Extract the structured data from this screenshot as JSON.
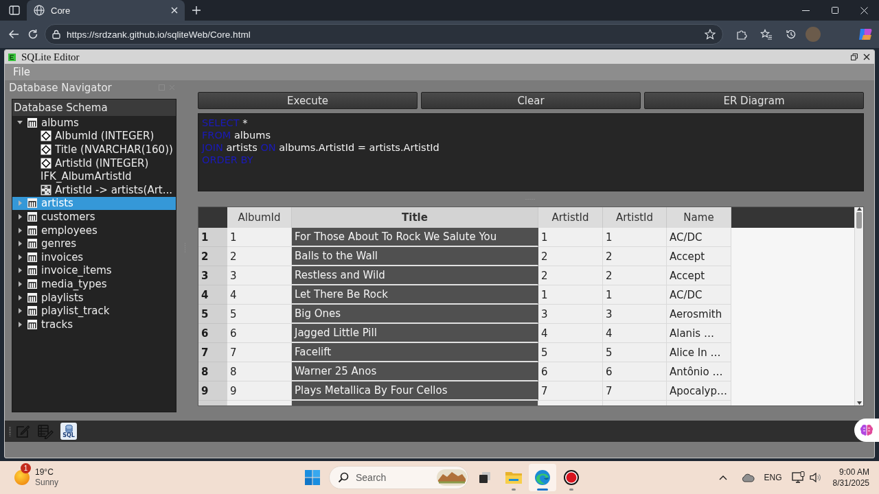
{
  "browser": {
    "tab": {
      "title": "Core"
    },
    "url": "https://srdzank.github.io/sqliteWeb/Core.html"
  },
  "app": {
    "title": "SQLite Editor",
    "menu": [
      {
        "label": "File"
      }
    ],
    "navigator": {
      "title": "Database Navigator",
      "header": "Database Schema",
      "tree": [
        {
          "kind": "table",
          "label": "albums",
          "expanded": true,
          "selected": false,
          "children": [
            {
              "kind": "column",
              "label": "AlbumId (INTEGER)",
              "selected": false
            },
            {
              "kind": "column",
              "label": "Title (NVARCHAR(160))",
              "selected": false
            },
            {
              "kind": "column",
              "label": "ArtistId (INTEGER)",
              "selected": false
            },
            {
              "kind": "index",
              "label": "IFK_AlbumArtistId",
              "selected": false
            },
            {
              "kind": "foreign_key",
              "label": "ArtistId -> artists(Art...",
              "selected": false
            }
          ]
        },
        {
          "kind": "table",
          "label": "artists",
          "expanded": false,
          "selected": true
        },
        {
          "kind": "table",
          "label": "customers",
          "expanded": false,
          "selected": false
        },
        {
          "kind": "table",
          "label": "employees",
          "expanded": false,
          "selected": false
        },
        {
          "kind": "table",
          "label": "genres",
          "expanded": false,
          "selected": false
        },
        {
          "kind": "table",
          "label": "invoices",
          "expanded": false,
          "selected": false
        },
        {
          "kind": "table",
          "label": "invoice_items",
          "expanded": false,
          "selected": false
        },
        {
          "kind": "table",
          "label": "media_types",
          "expanded": false,
          "selected": false
        },
        {
          "kind": "table",
          "label": "playlists",
          "expanded": false,
          "selected": false
        },
        {
          "kind": "table",
          "label": "playlist_track",
          "expanded": false,
          "selected": false
        },
        {
          "kind": "table",
          "label": "tracks",
          "expanded": false,
          "selected": false
        }
      ]
    },
    "buttons": [
      {
        "label": "Execute"
      },
      {
        "label": "Clear"
      },
      {
        "label": "ER Diagram"
      }
    ],
    "query": {
      "lines": [
        [
          {
            "kind": "keyword",
            "text": "SELECT"
          },
          {
            "kind": "plain",
            "text": " *"
          }
        ],
        [
          {
            "kind": "keyword",
            "text": "FROM"
          },
          {
            "kind": "plain",
            "text": " albums"
          }
        ],
        [
          {
            "kind": "keyword",
            "text": "JOIN"
          },
          {
            "kind": "plain",
            "text": " artists "
          },
          {
            "kind": "keyword",
            "text": "ON"
          },
          {
            "kind": "plain",
            "text": " albums.ArtistId = artists.ArtistId"
          }
        ],
        [
          {
            "kind": "keyword",
            "text": "ORDER BY"
          }
        ]
      ]
    },
    "results": {
      "columns": [
        {
          "label": "AlbumId",
          "selected": false
        },
        {
          "label": "Title",
          "selected": true
        },
        {
          "label": "ArtistId",
          "selected": false
        },
        {
          "label": "ArtistId",
          "selected": false
        },
        {
          "label": "Name",
          "selected": false
        }
      ],
      "rows": [
        {
          "number": "1",
          "cells": [
            "1",
            "For Those About To Rock We Salute You",
            "1",
            "1",
            "AC/DC"
          ]
        },
        {
          "number": "2",
          "cells": [
            "2",
            "Balls to the Wall",
            "2",
            "2",
            "Accept"
          ]
        },
        {
          "number": "3",
          "cells": [
            "3",
            "Restless and Wild",
            "2",
            "2",
            "Accept"
          ]
        },
        {
          "number": "4",
          "cells": [
            "4",
            "Let There Be Rock",
            "1",
            "1",
            "AC/DC"
          ]
        },
        {
          "number": "5",
          "cells": [
            "5",
            "Big Ones",
            "3",
            "3",
            "Aerosmith"
          ]
        },
        {
          "number": "6",
          "cells": [
            "6",
            "Jagged Little Pill",
            "4",
            "4",
            "Alanis …"
          ]
        },
        {
          "number": "7",
          "cells": [
            "7",
            "Facelift",
            "5",
            "5",
            "Alice In …"
          ]
        },
        {
          "number": "8",
          "cells": [
            "8",
            "Warner 25 Anos",
            "6",
            "6",
            "Antônio …"
          ]
        },
        {
          "number": "9",
          "cells": [
            "9",
            "Plays Metallica By Four Cellos",
            "7",
            "7",
            "Apocalyp…"
          ]
        }
      ]
    },
    "bottom_toolbar": [
      {
        "kind": "edit"
      },
      {
        "kind": "table_edit"
      },
      {
        "kind": "sql",
        "label": "SQL"
      }
    ]
  },
  "taskbar": {
    "weather": {
      "badge": "1",
      "temperature": "19°C",
      "condition": "Sunny"
    },
    "search": {
      "placeholder": "Search"
    },
    "apps": [
      {
        "kind": "task_view",
        "selected": false,
        "running": false
      },
      {
        "kind": "file_explorer",
        "selected": false,
        "running": true
      },
      {
        "kind": "edge",
        "selected": true,
        "running": true
      },
      {
        "kind": "recorder",
        "selected": false,
        "running": true
      }
    ],
    "tray": {
      "language": "ENG",
      "time": "9:00 AM",
      "date": "8/31/2025"
    }
  }
}
